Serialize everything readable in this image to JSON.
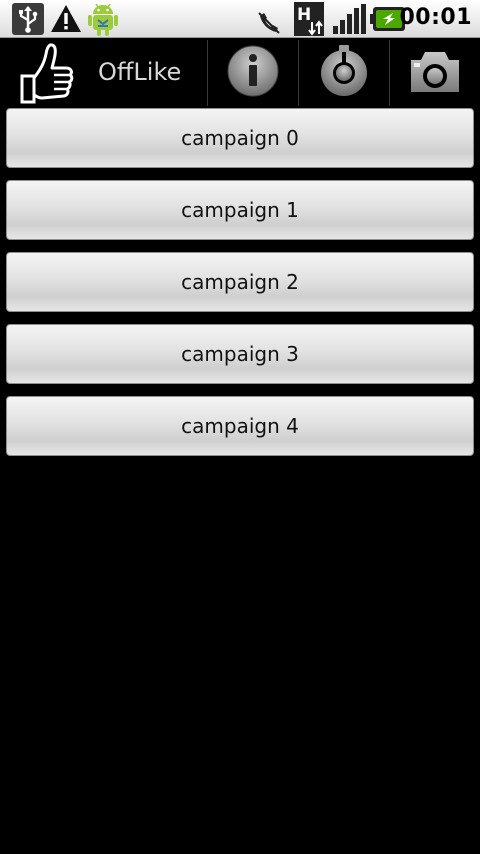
{
  "status_bar": {
    "time": "00:01",
    "icons": [
      "usb-icon",
      "warning-icon",
      "android-debug-icon",
      "phone-muted-icon",
      "h-network-icon",
      "signal-icon",
      "battery-charging-icon"
    ]
  },
  "action_bar": {
    "app_title": "OffLike",
    "logo_icon": "thumbs-up-icon",
    "actions": [
      {
        "icon": "info-icon"
      },
      {
        "icon": "timer-icon"
      },
      {
        "icon": "camera-icon"
      }
    ]
  },
  "campaigns": [
    {
      "label": "campaign 0"
    },
    {
      "label": "campaign 1"
    },
    {
      "label": "campaign 2"
    },
    {
      "label": "campaign 3"
    },
    {
      "label": "campaign 4"
    }
  ],
  "colors": {
    "background": "#000000",
    "status_bar": "#e8e8e8",
    "battery_green": "#4aa800",
    "button_face": "#e2e2e2"
  }
}
